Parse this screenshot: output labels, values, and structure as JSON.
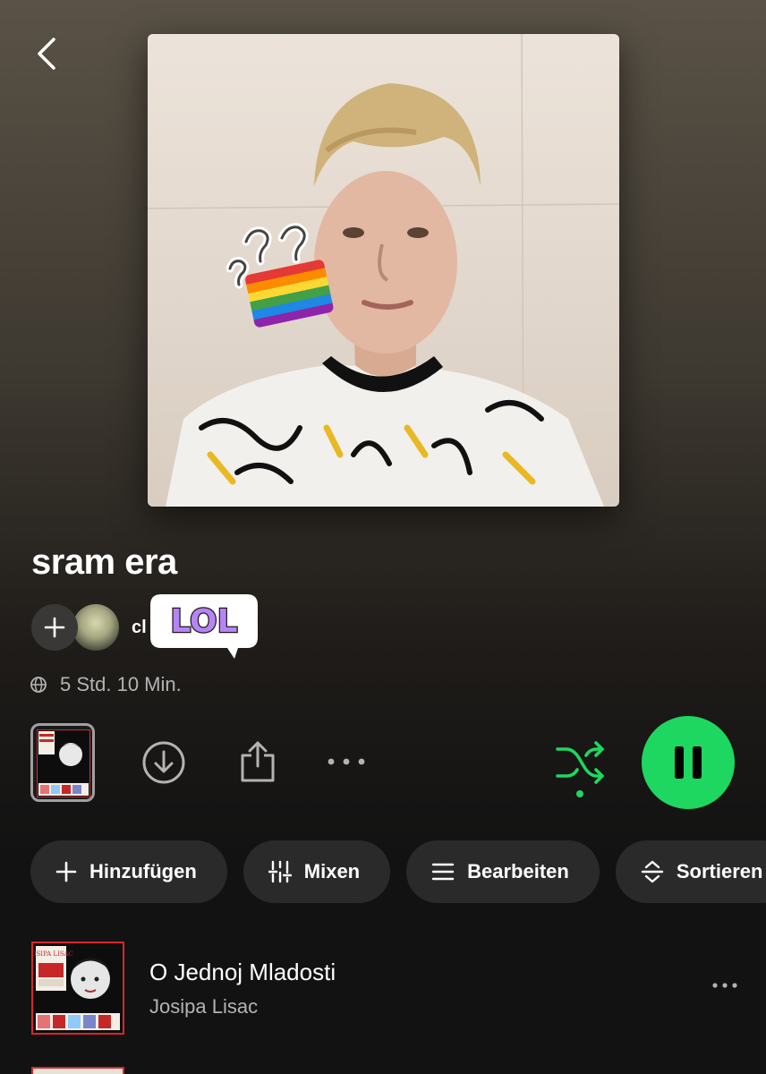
{
  "playlist": {
    "title": "sram era",
    "owner_name": "cl",
    "duration": "5 Std. 10 Min.",
    "sticker_text": "LOL"
  },
  "actions": {
    "chips": [
      {
        "label": "Hinzufügen",
        "icon": "plus-icon"
      },
      {
        "label": "Mixen",
        "icon": "sliders-icon"
      },
      {
        "label": "Bearbeiten",
        "icon": "list-icon"
      },
      {
        "label": "Sortieren",
        "icon": "sort-icon"
      }
    ]
  },
  "tracks": [
    {
      "title": "O Jednoj Mladosti",
      "artist": "Josipa Lisac",
      "art_text": "JOSIPA LISAC"
    }
  ],
  "colors": {
    "accent": "#1ed760",
    "background": "#121212",
    "chip": "#2a2a2a",
    "secondary_text": "#b3b3b3"
  }
}
